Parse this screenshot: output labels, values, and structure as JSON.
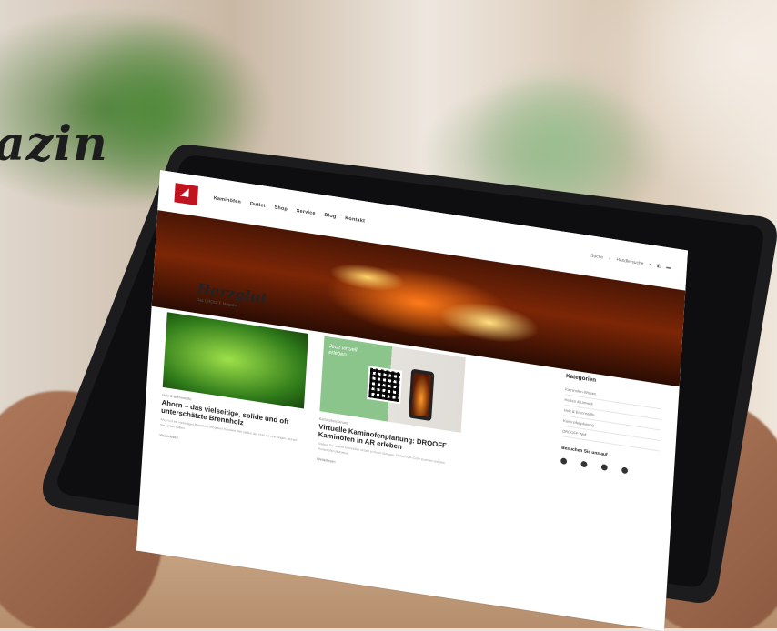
{
  "headline": "azin",
  "site": {
    "nav": [
      "Kaminöfen",
      "Outlet",
      "Shop",
      "Service",
      "Blog",
      "Kontakt"
    ],
    "nav_right": [
      "Suche",
      "Händlersuche"
    ],
    "brand": "Herzglut",
    "brand_sub": "Das DROOFF Magazin",
    "cards": [
      {
        "tag": "Holz & Brennstoffe",
        "title": "Ahorn – das vielseitige, solide und oft unterschätzte Brennholz",
        "text": "Ahorn ist ein vielseitiges Brennholz mit gutem Heizwert. Wir stellen das Holz vor und zeigen, worauf Sie achten sollten.",
        "foot": "Weiterlesen"
      },
      {
        "tag": "Kaminofenplanung",
        "title": "Virtuelle Kaminofenplanung: DROOFF Kaminöfen in AR erleben",
        "text": "Erleben Sie unsere Kaminöfen virtuell in Ihrem Zuhause. Einfach QR-Code scannen und den Wunschofen platzieren.",
        "foot": "Weiterlesen",
        "img_text": "Jetzt virtuell erleben"
      }
    ],
    "sidebar": {
      "title": "Kategorien",
      "items": [
        "Kaminofen-Wissen",
        "Heizen & Umwelt",
        "Holz & Brennstoffe",
        "Kaminofenplanung",
        "DROOFF Welt"
      ],
      "follow": "Besuchen Sie uns auf"
    }
  },
  "colors": {
    "brand_red": "#c1121f",
    "hero_fire": "#ff7a18",
    "green": "#8bc58b"
  }
}
